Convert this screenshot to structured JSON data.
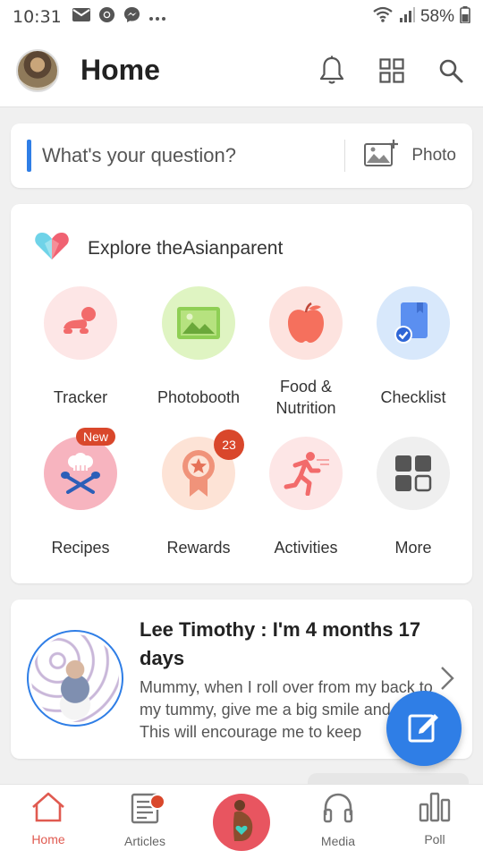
{
  "status_bar": {
    "time": "10:31",
    "battery": "58%",
    "icons": [
      "mail-icon",
      "chrome-icon",
      "messenger-icon",
      "more-dots-icon",
      "wifi-icon",
      "signal-icon",
      "battery-icon"
    ]
  },
  "header": {
    "title": "Home",
    "icons": [
      "bell-icon",
      "grid-icon",
      "search-icon"
    ]
  },
  "question": {
    "placeholder": "What's your question?",
    "photo_label": "Photo"
  },
  "explore": {
    "title": "Explore theAsianparent",
    "items": [
      {
        "label": "Tracker",
        "icon": "baby-crawl-icon"
      },
      {
        "label": "Photobooth",
        "icon": "photo-icon"
      },
      {
        "label": "Food & Nutrition",
        "icon": "apple-icon"
      },
      {
        "label": "Checklist",
        "icon": "checklist-icon"
      },
      {
        "label": "Recipes",
        "icon": "chef-icon",
        "badge": "New"
      },
      {
        "label": "Rewards",
        "icon": "medal-icon",
        "badge": "23"
      },
      {
        "label": "Activities",
        "icon": "running-icon"
      },
      {
        "label": "More",
        "icon": "more-grid-icon"
      }
    ]
  },
  "baby_card": {
    "title": "Lee Timothy : I'm 4 months 17 days",
    "text": "Mummy, when I roll over from my back to my tummy, give me a big smile and clap! This will encourage me to keep"
  },
  "bottom_nav": {
    "items": [
      {
        "label": "Home",
        "icon": "home-icon",
        "active": true
      },
      {
        "label": "Articles",
        "icon": "articles-icon"
      },
      {
        "label": "",
        "icon": "pregnancy-icon"
      },
      {
        "label": "Media",
        "icon": "headphones-icon"
      },
      {
        "label": "Poll",
        "icon": "poll-icon"
      }
    ]
  },
  "colors": {
    "accent_blue": "#2f7ee6",
    "badge_red": "#d9472b",
    "nav_active": "#e05a50",
    "center_button": "#e85560"
  }
}
